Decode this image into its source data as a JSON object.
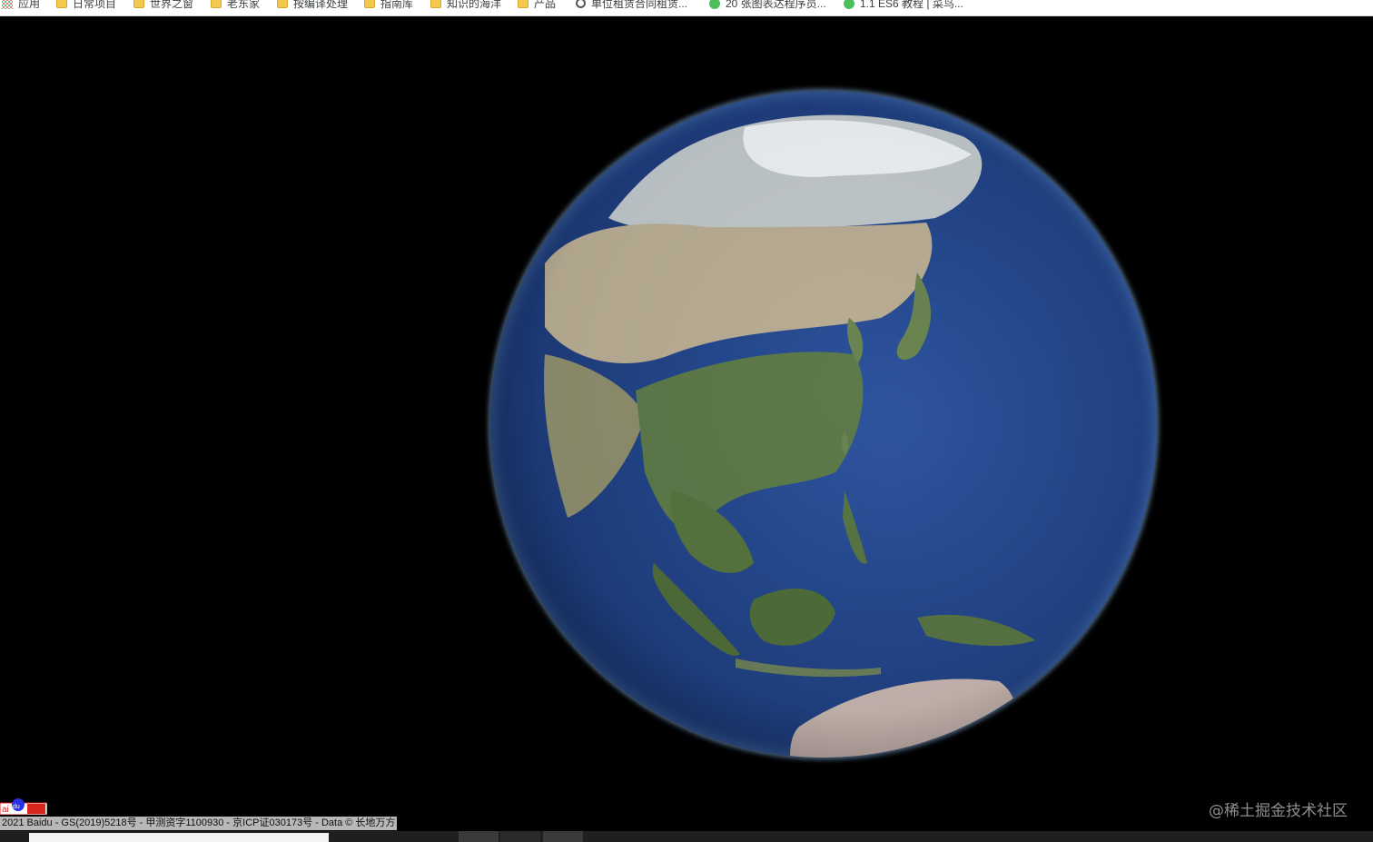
{
  "bookmarks": [
    {
      "label": "应用",
      "icon": "apps-icon"
    },
    {
      "label": "日常项目",
      "icon": "folder-icon"
    },
    {
      "label": "世界之窗",
      "icon": "folder-icon"
    },
    {
      "label": "老东家",
      "icon": "folder-icon"
    },
    {
      "label": "按编译处理",
      "icon": "folder-icon"
    },
    {
      "label": "指南库",
      "icon": "folder-icon"
    },
    {
      "label": "知识的海洋",
      "icon": "folder-icon"
    },
    {
      "label": "产品",
      "icon": "folder-icon"
    },
    {
      "label": "单位租赁合同租赁...",
      "icon": "link-icon"
    },
    {
      "label": "20 张图表达程序员...",
      "icon": "wechat-icon"
    },
    {
      "label": "1.1 ES6 教程 | 菜鸟...",
      "icon": "wechat-icon"
    }
  ],
  "map": {
    "copyright": "2021 Baidu - GS(2019)5218号 - 甲测资字1100930 - 京ICP证030173号 - Data © 长地万方",
    "logo_text": "百度地图",
    "watermark": "@稀土掘金技术社区"
  },
  "colors": {
    "space": "#000000",
    "ocean": "#24478c",
    "land_green": "#5d7a4a",
    "land_desert": "#b9ad94",
    "snow": "#e8ecf0",
    "atmosphere": "#9fd0ff"
  }
}
